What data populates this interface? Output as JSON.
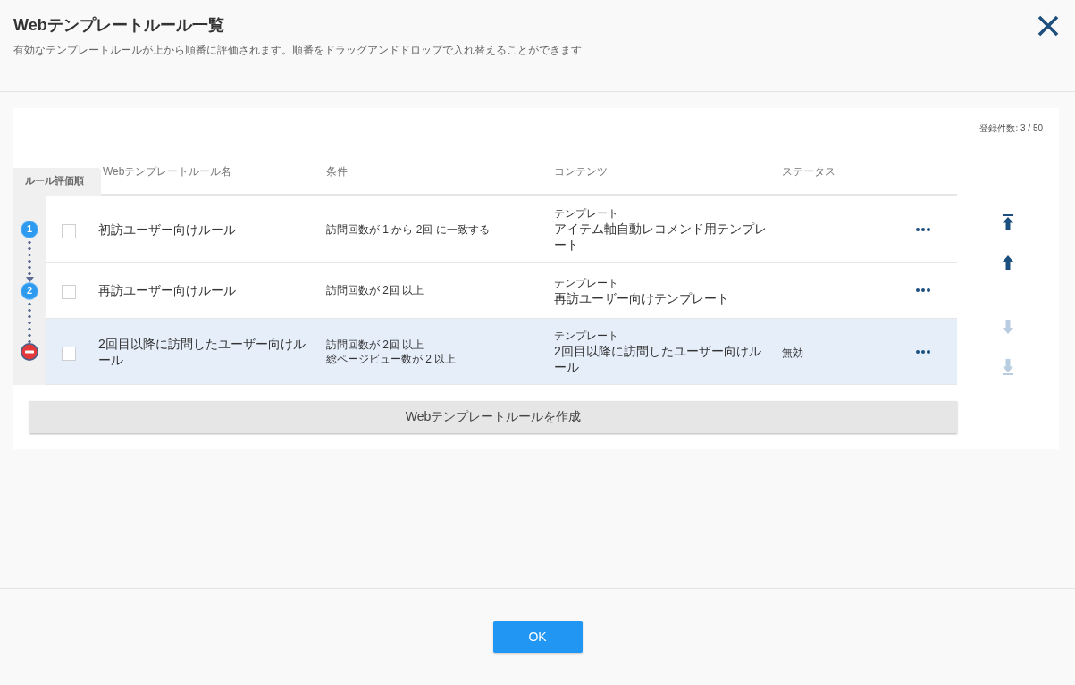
{
  "dialog": {
    "title": "Webテンプレートルール一覧",
    "description": "有効なテンプレートルールが上から順番に評価されます。順番をドラッグアンドドロップで入れ替えることができます"
  },
  "registration_count": "登録件数: 3 / 50",
  "order_tab": "ルール評価順",
  "columns": [
    "Webテンプレートルール名",
    "条件",
    "コンテンツ",
    "ステータス"
  ],
  "rows": [
    {
      "order": "1",
      "enabled": true,
      "selected": false,
      "checked": false,
      "name": "初訪ユーザー向けルール",
      "conditions": [
        "訪問回数が 1 から 2回 に一致する"
      ],
      "content_type": "テンプレート",
      "content": "アイテム軸自動レコメンド用テンプレート"
    },
    {
      "order": "2",
      "enabled": true,
      "selected": false,
      "checked": false,
      "name": "再訪ユーザー向けルール",
      "conditions": [
        "訪問回数が 2回 以上"
      ],
      "content_type": "テンプレート",
      "content": "再訪ユーザー向けテンプレート"
    },
    {
      "enabled": false,
      "selected": true,
      "checked": false,
      "name": "2回目以降に訪問したユーザー向けルール",
      "conditions": [
        "訪問回数が 2回 以上",
        "総ページビュー数が 2 以上"
      ],
      "content_type": "テンプレート",
      "content": "2回目以降に訪問したユーザー向けルール",
      "status": "無効"
    }
  ],
  "move_buttons": [
    {
      "kind": "top",
      "disabled": false
    },
    {
      "kind": "up",
      "disabled": false
    },
    {
      "kind": "down",
      "disabled": true
    },
    {
      "kind": "bottom",
      "disabled": true
    }
  ],
  "create_button": "Webテンプレートルールを作成",
  "ok_button": "OK"
}
